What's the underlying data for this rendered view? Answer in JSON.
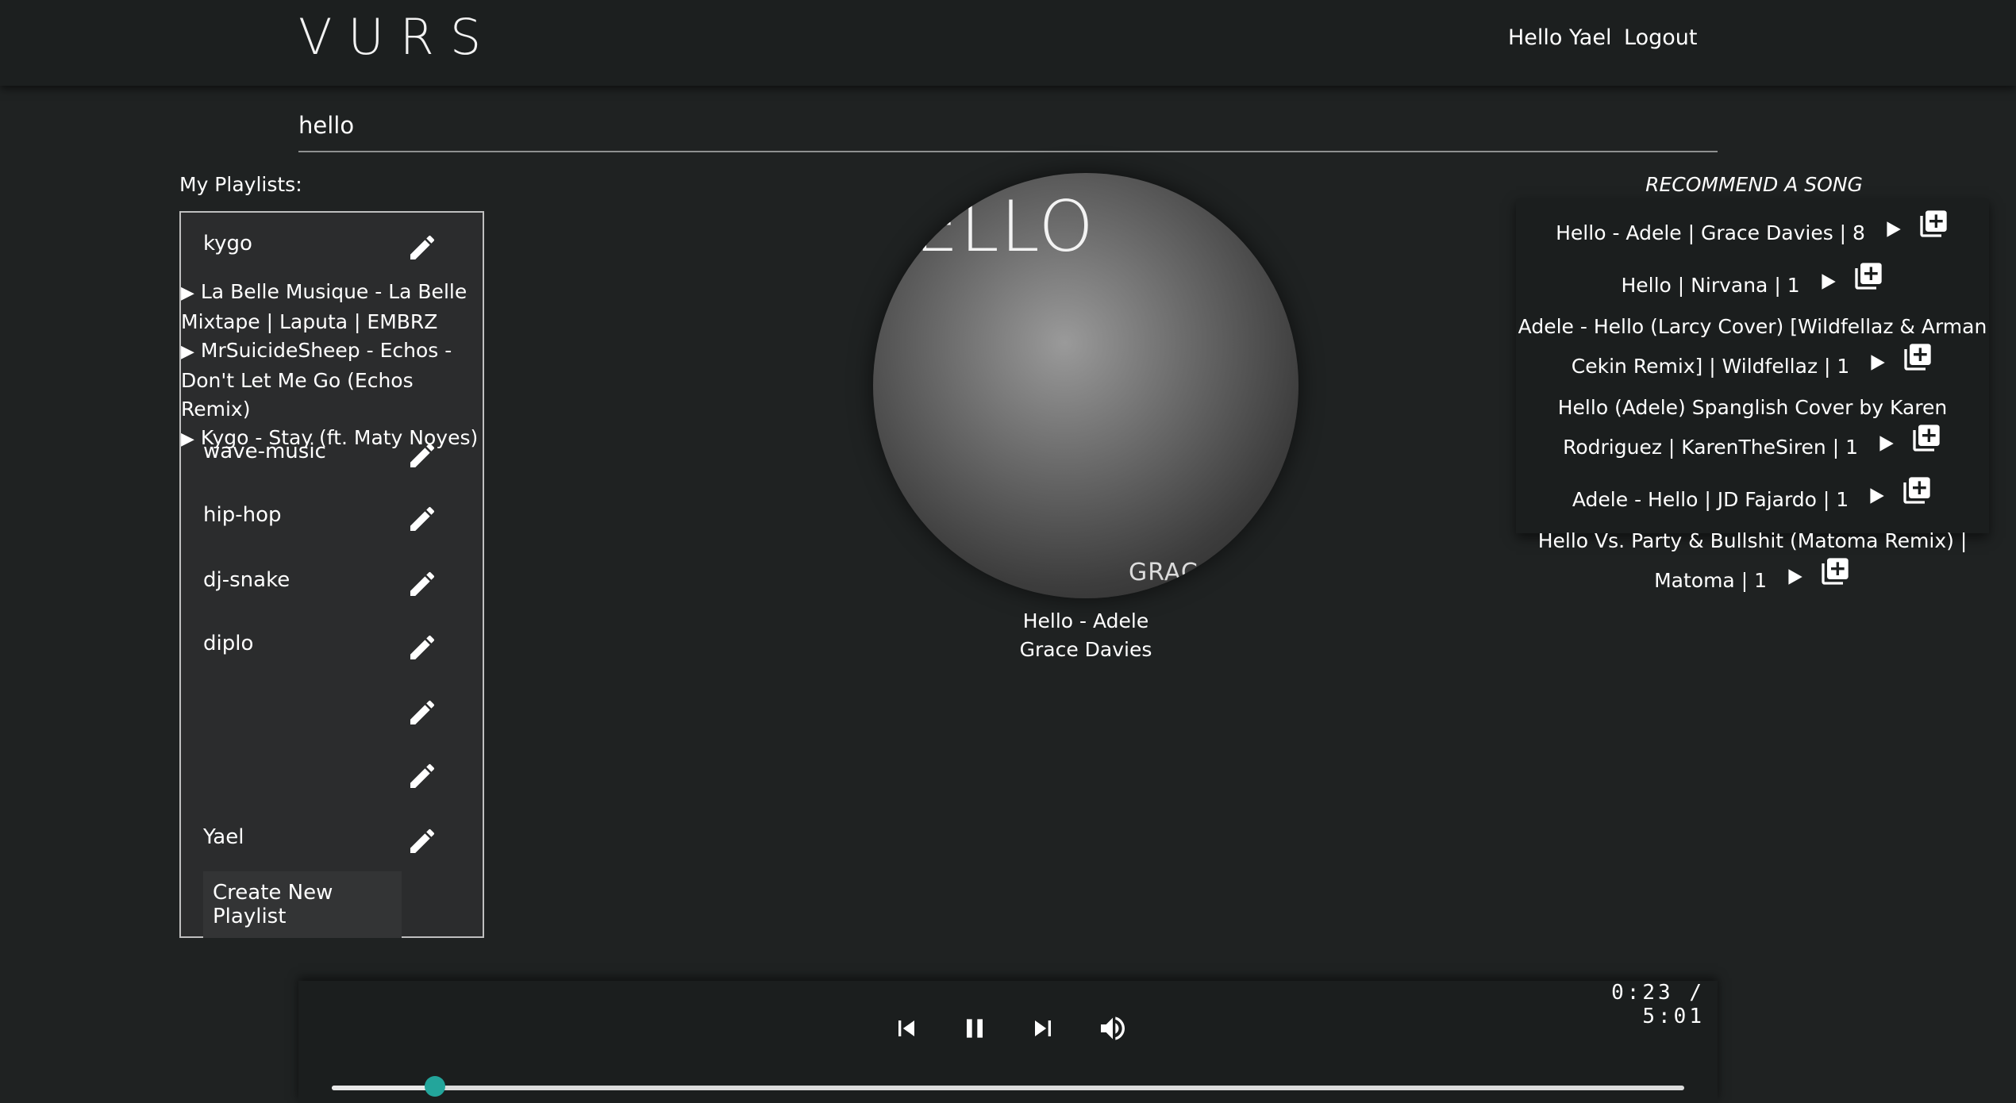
{
  "header": {
    "logo": "VURS",
    "greeting": "Hello Yael",
    "logout": "Logout"
  },
  "search": {
    "value": "hello",
    "placeholder": ""
  },
  "playlists": {
    "title": "My Playlists:",
    "items": [
      {
        "name": "kygo"
      },
      {
        "name": "wave-music"
      },
      {
        "name": "hip-hop"
      },
      {
        "name": "dj-snake"
      },
      {
        "name": "diplo"
      },
      {
        "name": ""
      },
      {
        "name": ""
      },
      {
        "name": "Yael"
      }
    ],
    "expanded_tracks": [
      "La Belle Musique - La Belle Mixtape | Laputa | EMBRZ",
      "MrSuicideSheep - Echos - Don't Let Me Go (Echos Remix)",
      "Kygo - Stay (ft. Maty Noyes)"
    ],
    "track_marker": "▶",
    "create_label": "Create New Playlist"
  },
  "now_playing": {
    "art_text": "ELLO",
    "art_sub": "GRAC",
    "title": "Hello - Adele",
    "artist": "Grace Davies"
  },
  "recommend": {
    "title": "RECOMMEND A SONG",
    "items": [
      {
        "text": "Hello - Adele | Grace Davies | 8"
      },
      {
        "text": "Hello | Nirvana | 1"
      },
      {
        "text": "Adele - Hello (Larcy Cover) [Wildfellaz & Arman Cekin Remix] | Wildfellaz | 1"
      },
      {
        "text": "Hello (Adele) Spanglish Cover by Karen Rodriguez | KarenTheSiren | 1"
      },
      {
        "text": "Adele - Hello | JD Fajardo | 1"
      },
      {
        "text": "Hello Vs. Party & Bullshit (Matoma Remix) | Matoma | 1"
      }
    ]
  },
  "player": {
    "time": "0:23 / 5:01",
    "progress": 0.0764,
    "icons": [
      "skip-previous-icon",
      "pause-icon",
      "skip-next-icon",
      "volume-icon"
    ]
  },
  "colors": {
    "background": "#1f2222",
    "panel": "#2b2c2d",
    "accent": "#23a59b"
  }
}
